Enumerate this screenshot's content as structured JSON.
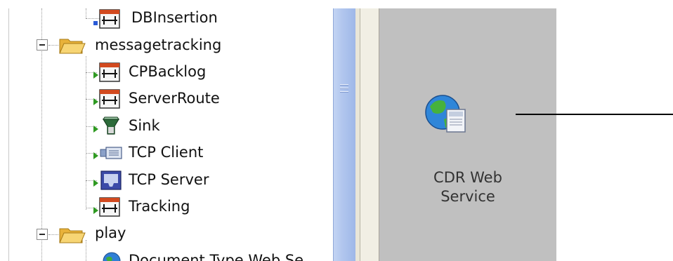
{
  "tree": {
    "items": [
      {
        "label": "DBInsertion",
        "icon": "component-icon"
      },
      {
        "label": "messagetracking",
        "icon": "folder-open-icon"
      },
      {
        "label": "CPBacklog",
        "icon": "component-icon"
      },
      {
        "label": "ServerRoute",
        "icon": "component-icon"
      },
      {
        "label": "Sink",
        "icon": "sink-icon"
      },
      {
        "label": "TCP Client",
        "icon": "tcp-client-icon"
      },
      {
        "label": "TCP Server",
        "icon": "tcp-server-icon"
      },
      {
        "label": "Tracking",
        "icon": "component-icon"
      },
      {
        "label": "play",
        "icon": "folder-open-icon"
      },
      {
        "label": "Document Type Web Se",
        "icon": "globe-icon"
      }
    ]
  },
  "canvas": {
    "node_label": "CDR Web\nService",
    "node_icon": "web-service-globe-icon"
  },
  "colors": {
    "canvas_bg": "#c0c0c0",
    "splitter": "#b1c6ee",
    "folder": "#f2c14e",
    "arrow_green": "#2f9a22"
  }
}
